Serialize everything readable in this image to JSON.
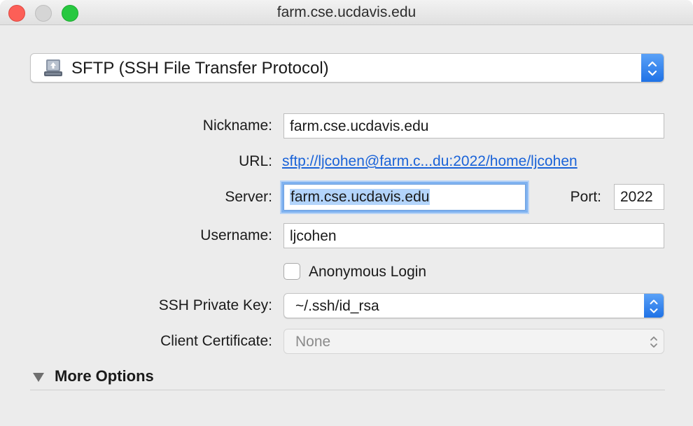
{
  "window": {
    "title": "farm.cse.ucdavis.edu"
  },
  "protocol": {
    "selected": "SFTP (SSH File Transfer Protocol)",
    "icon": "network-drive-icon"
  },
  "form": {
    "nickname": {
      "label": "Nickname:",
      "value": "farm.cse.ucdavis.edu"
    },
    "url": {
      "label": "URL:",
      "value": "sftp://ljcohen@farm.c...du:2022/home/ljcohen"
    },
    "server": {
      "label": "Server:",
      "value": "farm.cse.ucdavis.edu"
    },
    "port": {
      "label": "Port:",
      "value": "2022"
    },
    "username": {
      "label": "Username:",
      "value": "ljcohen"
    },
    "anonymous": {
      "label": "Anonymous Login",
      "checked": false
    },
    "ssh_key": {
      "label": "SSH Private Key:",
      "value": "~/.ssh/id_rsa"
    },
    "client_cert": {
      "label": "Client Certificate:",
      "value": "None",
      "disabled": true
    }
  },
  "more_options": {
    "label": "More Options",
    "expanded": true
  },
  "colors": {
    "accent": "#1f72e6",
    "link": "#1a63d8",
    "close": "#fc5f57",
    "zoom": "#27c840"
  }
}
